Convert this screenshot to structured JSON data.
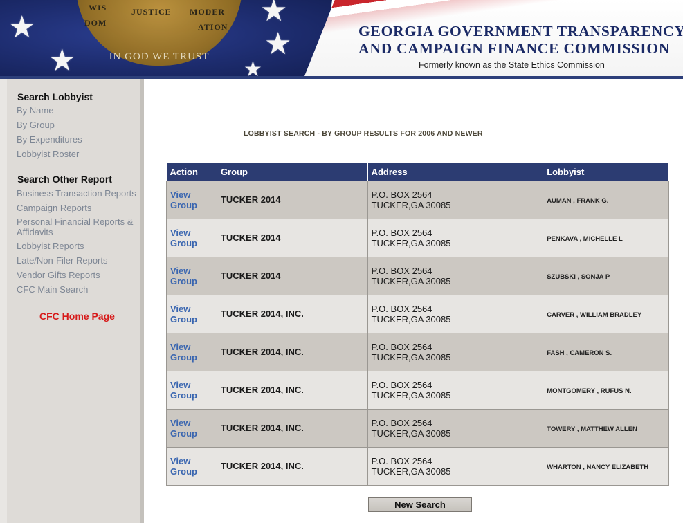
{
  "header": {
    "title_line1": "GEORGIA GOVERNMENT TRANSPARENCY",
    "title_line2": "AND CAMPAIGN FINANCE COMMISSION",
    "subtitle": "Formerly known as the State Ethics Commission",
    "seal_motto": "IN GOD WE TRUST",
    "seal_banners": [
      "WIS",
      "DOM",
      "JUSTICE",
      "MODER",
      "ATION"
    ]
  },
  "sidebar": {
    "section1_heading": "Search Lobbyist",
    "section1_links": [
      "By Name",
      "By Group",
      "By Expenditures",
      "Lobbyist Roster"
    ],
    "section2_heading": "Search Other Report",
    "section2_links": [
      "Business Transaction Reports",
      "Campaign Reports",
      "Personal Financial Reports &",
      "Affidavits",
      "Lobbyist Reports",
      "Late/Non-Filer Reports",
      "Vendor Gifts Reports",
      "CFC Main Search"
    ],
    "home_link": "CFC Home Page"
  },
  "main": {
    "heading": "LOBBYIST SEARCH - BY GROUP RESULTS FOR 2006 AND NEWER",
    "table": {
      "columns": [
        "Action",
        "Group",
        "Address",
        "Lobbyist"
      ],
      "action_line1": "View",
      "action_line2": "Group",
      "rows": [
        {
          "group": "TUCKER 2014",
          "addr1": "P.O. BOX 2564",
          "addr2": "TUCKER,GA 30085",
          "lobbyist": "AUMAN , FRANK G."
        },
        {
          "group": "TUCKER 2014",
          "addr1": "P.O. BOX 2564",
          "addr2": "TUCKER,GA 30085",
          "lobbyist": "PENKAVA , MICHELLE L"
        },
        {
          "group": "TUCKER 2014",
          "addr1": "P.O. BOX 2564",
          "addr2": "TUCKER,GA 30085",
          "lobbyist": "SZUBSKI , SONJA P"
        },
        {
          "group": "TUCKER 2014, INC.",
          "addr1": "P.O. BOX 2564",
          "addr2": "TUCKER,GA 30085",
          "lobbyist": "CARVER , WILLIAM BRADLEY"
        },
        {
          "group": "TUCKER 2014, INC.",
          "addr1": "P.O. BOX 2564",
          "addr2": "TUCKER,GA 30085",
          "lobbyist": "FASH , CAMERON S."
        },
        {
          "group": "TUCKER 2014, INC.",
          "addr1": "P.O. BOX 2564",
          "addr2": "TUCKER,GA 30085",
          "lobbyist": "MONTGOMERY , RUFUS N."
        },
        {
          "group": "TUCKER 2014, INC.",
          "addr1": "P.O. BOX 2564",
          "addr2": "TUCKER,GA 30085",
          "lobbyist": "TOWERY , MATTHEW ALLEN"
        },
        {
          "group": "TUCKER 2014, INC.",
          "addr1": "P.O. BOX 2564",
          "addr2": "TUCKER,GA 30085",
          "lobbyist": "WHARTON , NANCY ELIZABETH"
        }
      ]
    },
    "new_search_label": "New Search"
  }
}
